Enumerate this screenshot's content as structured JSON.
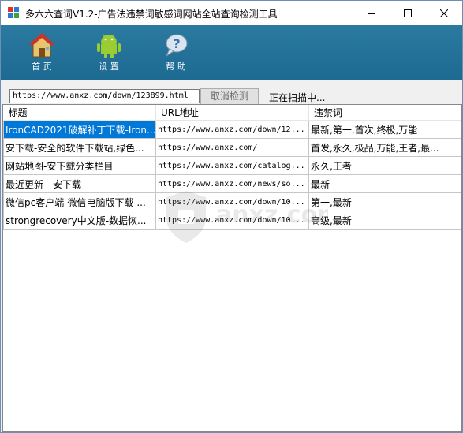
{
  "window": {
    "title": "多六六查词V1.2-广告法违禁词敏感词网站全站查询检测工具",
    "minimize_icon": "minimize-icon",
    "maximize_icon": "maximize-icon",
    "close_icon": "close-icon"
  },
  "toolbar": {
    "items": [
      {
        "label": "首 页",
        "icon": "home-icon"
      },
      {
        "label": "设 置",
        "icon": "android-settings-icon"
      },
      {
        "label": "帮 助",
        "icon": "help-icon"
      }
    ],
    "background": "#2477a0"
  },
  "scan": {
    "url_value": "https://www.anxz.com/down/123899.html",
    "cancel_label": "取消检测",
    "status_text": "正在扫描中..."
  },
  "table": {
    "headers": [
      "标题",
      "URL地址",
      "违禁词"
    ],
    "rows": [
      {
        "title": "IronCAD2021破解补丁下载-Iron...",
        "url": "https://www.anxz.com/down/12...",
        "words": "最新,第一,首次,终极,万能"
      },
      {
        "title": "安下载-安全的软件下载站,绿色...",
        "url": "https://www.anxz.com/",
        "words": "首发,永久,极品,万能,王者,最..."
      },
      {
        "title": "网站地图-安下载分类栏目",
        "url": "https://www.anxz.com/catalog...",
        "words": "永久,王者"
      },
      {
        "title": "最近更新 - 安下载",
        "url": "https://www.anxz.com/news/so...",
        "words": "最新"
      },
      {
        "title": "微信pc客户端-微信电脑版下载 ...",
        "url": "https://www.anxz.com/down/10...",
        "words": "第一,最新"
      },
      {
        "title": "strongrecovery中文版-数据恢...",
        "url": "https://www.anxz.com/down/10...",
        "words": "高级,最新"
      }
    ],
    "selected_row": 0,
    "selection_color": "#0078d7"
  },
  "watermark": {
    "text": "anxz.com",
    "icon": "shield-watermark-icon"
  }
}
